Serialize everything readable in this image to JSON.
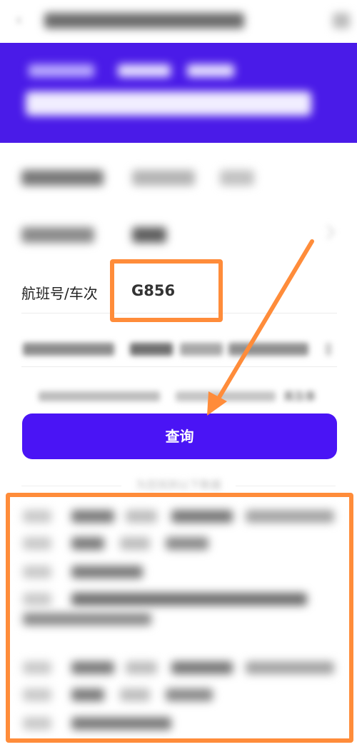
{
  "form": {
    "flight_label": "航班号/车次",
    "flight_value": "G856",
    "agreement_tail": "乘及事"
  },
  "button": {
    "query_label": "查询"
  },
  "results": {
    "hint": "为您找到以下数据"
  },
  "colors": {
    "brand": "#4a14f5",
    "banner": "#4a1be8",
    "annotation": "#ff8c3a"
  },
  "icons": {
    "back": "back-arrow-icon",
    "dropdown": "chevron-right-icon"
  }
}
